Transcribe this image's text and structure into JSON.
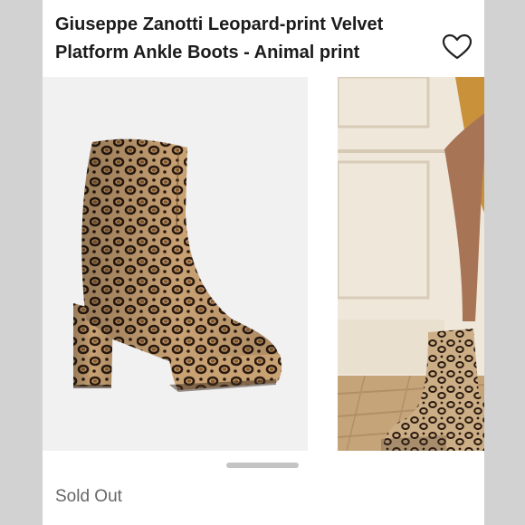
{
  "listing": {
    "brand": "Giuseppe Zanotti",
    "title": "Leopard-print Velvet Platform Ankle Boots - Animal print",
    "like_icon": "heart-outline-icon",
    "status": "Sold Out"
  },
  "gallery": {
    "images": [
      {
        "name": "boot-product-photo"
      },
      {
        "name": "boot-lifestyle-photo"
      }
    ]
  },
  "colors": {
    "background": "#d2d2d2",
    "card": "#ffffff",
    "text": "#1c1c1c",
    "status_text": "#666666"
  }
}
